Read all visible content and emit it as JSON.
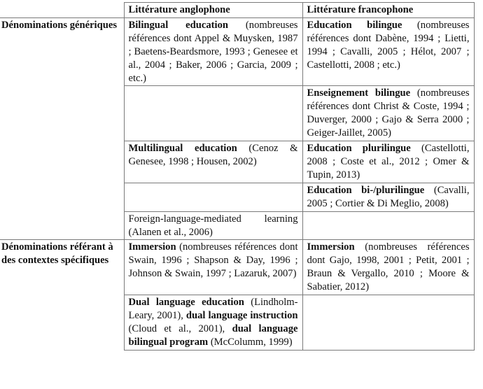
{
  "table": {
    "headers": {
      "col1": "",
      "col2": "Littérature anglophone",
      "col3": "Littérature francophone"
    },
    "groups": [
      {
        "label": "Dénominations génériques",
        "rows": [
          {
            "anglophone": {
              "term": "Bilingual education",
              "refs": " (nombreuses références dont Appel & Muysken, 1987 ; Baetens-Beardsmore, 1993 ; Genesee et al., 2004 ; Baker, 2006 ; Garcia, 2009 ; etc.)"
            },
            "francophone": {
              "term": "Education bilingue",
              "refs": " (nombreuses références dont Dabène, 1994 ; Lietti, 1994 ; Cavalli, 2005 ; Hélot, 2007 ; Castellotti, 2008 ;    etc.)"
            }
          },
          {
            "anglophone": null,
            "francophone": {
              "term": "Enseignement bilingue",
              "refs": " (nombreuses références dont Christ & Coste, 1994 ; Duverger, 2000 ; Gajo & Serra 2000 ; Geiger-Jaillet, 2005)"
            }
          },
          {
            "anglophone": {
              "term": "Multilingual education",
              "refs": " (Cenoz & Genesee, 1998 ; Housen, 2002)"
            },
            "francophone": {
              "term": "Education plurilingue",
              "refs": " (Castellotti, 2008 ; Coste et al., 2012 ; Omer & Tupin, 2013)"
            }
          },
          {
            "anglophone": null,
            "francophone": {
              "term": "Education bi-/plurilingue",
              "refs": " (Cavalli, 2005 ; Cortier & Di Meglio, 2008)"
            }
          },
          {
            "anglophone": {
              "term": "",
              "refs": "Foreign-language-mediated learning (Alanen et al., 2006)"
            },
            "francophone": null
          }
        ]
      },
      {
        "label": "Dénominations référant à des contextes spécifiques",
        "rows": [
          {
            "anglophone": {
              "term": "Immersion",
              "refs": " (nombreuses références dont Swain, 1996 ; Shapson & Day, 1996 ; Johnson & Swain, 1997 ; Lazaruk, 2007)"
            },
            "francophone": {
              "term": "Immersion",
              "refs": " (nombreuses références dont Gajo, 1998, 2001 ; Petit, 2001 ; Braun & Vergallo, 2010 ; Moore & Sabatier, 2012)"
            }
          },
          {
            "anglophone": {
              "parts": [
                {
                  "bold": true,
                  "text": "Dual language education"
                },
                {
                  "bold": false,
                  "text": " (Lindholm-Leary, 2001), "
                },
                {
                  "bold": true,
                  "text": "dual language instruction"
                },
                {
                  "bold": false,
                  "text": " (Cloud et al., 2001), "
                },
                {
                  "bold": true,
                  "text": "dual language bilingual program"
                },
                {
                  "bold": false,
                  "text": " (McColumm, 1999)"
                }
              ]
            },
            "francophone": null
          }
        ]
      }
    ]
  }
}
